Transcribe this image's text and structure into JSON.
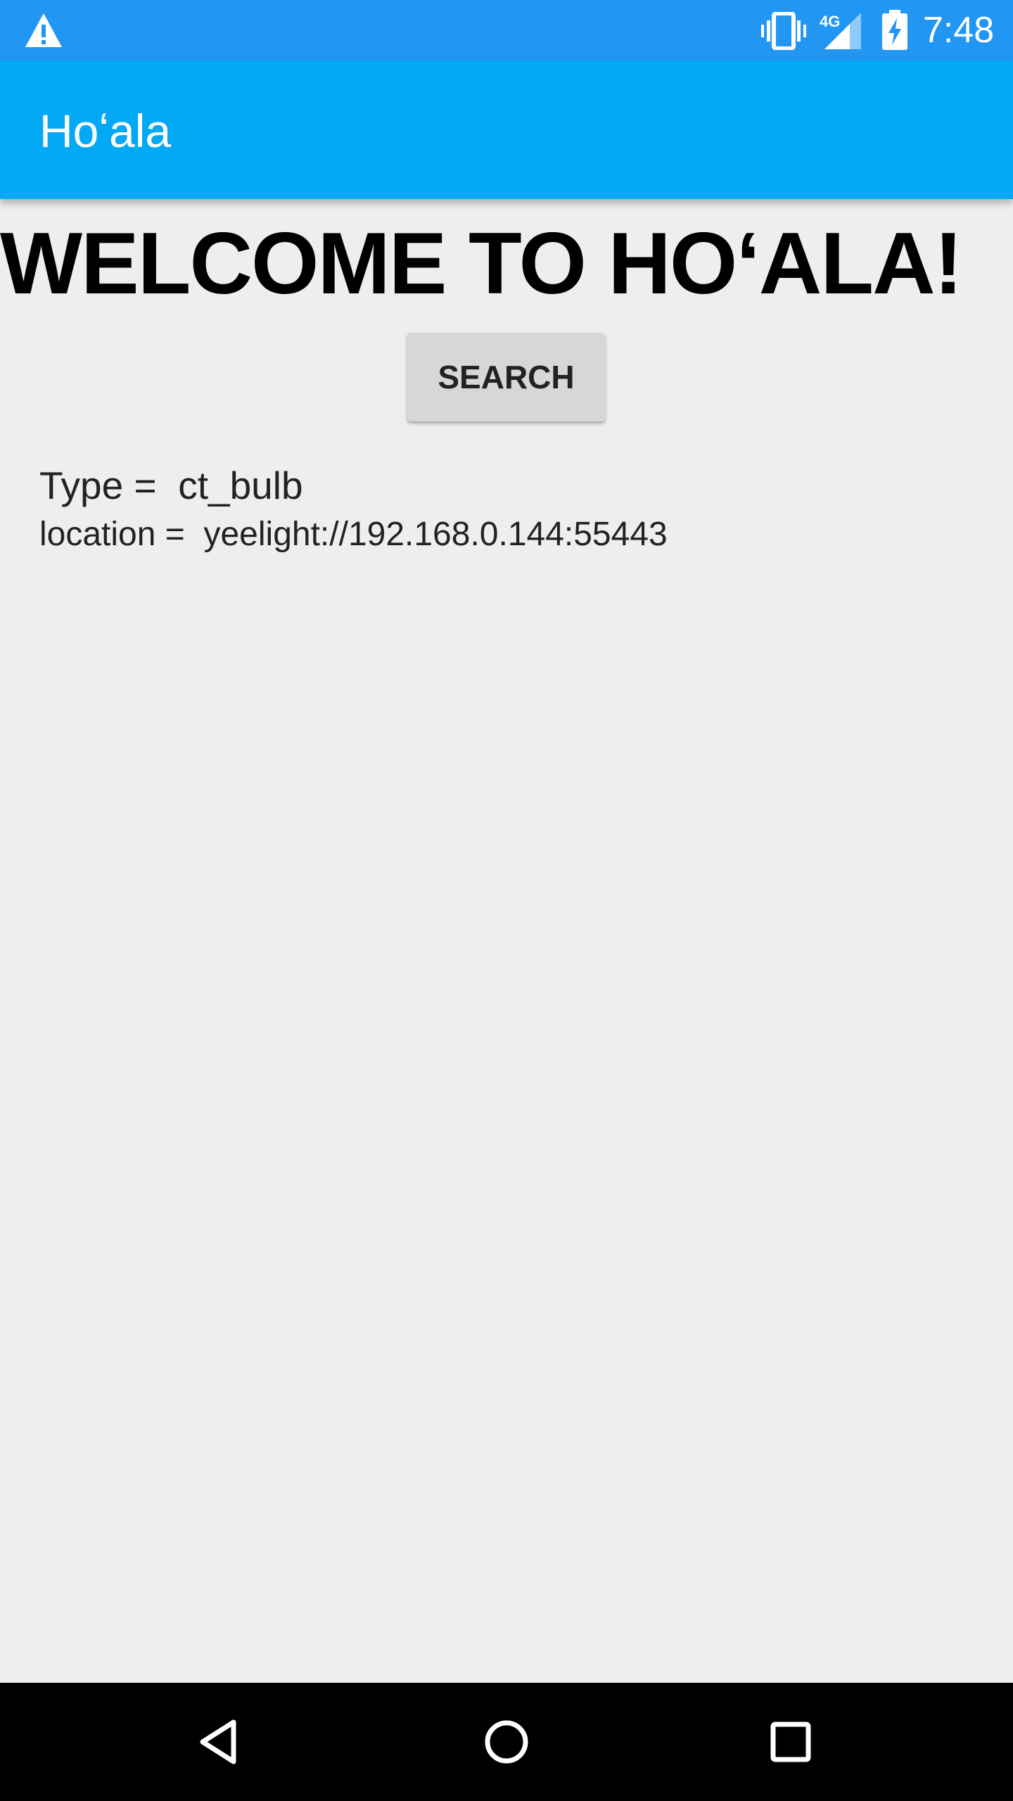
{
  "status_bar": {
    "network_type": "4G",
    "time": "7:48",
    "icons": [
      "warning-icon",
      "vibrate-icon",
      "signal-icon",
      "battery-charging-icon"
    ]
  },
  "app_bar": {
    "title": "Hoʻala"
  },
  "main": {
    "welcome_heading": "WELCOME TO HOʻALA!",
    "search_button_label": "SEARCH",
    "type_line": "Type =  ct_bulb",
    "location_line": "location =  yeelight://192.168.0.144:55443"
  },
  "nav_bar": {
    "icons": [
      "back-icon",
      "home-icon",
      "recents-icon"
    ]
  },
  "colors": {
    "status_bar": "#2196f3",
    "app_bar": "#03a9f4",
    "background": "#eeeeee",
    "button": "#d6d7d7",
    "nav_bar": "#000000"
  }
}
